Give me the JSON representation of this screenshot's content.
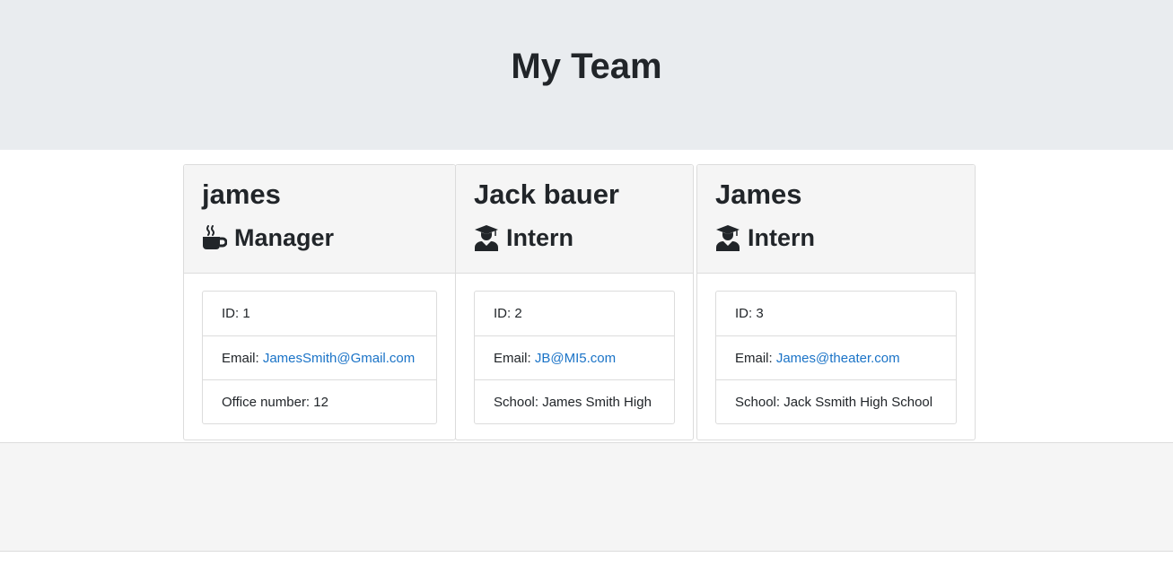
{
  "page": {
    "title": "My Team"
  },
  "team": [
    {
      "name": "james",
      "role": "Manager",
      "role_icon": "coffee-mug-icon",
      "id_label": "ID: 1",
      "email_prefix": "Email: ",
      "email": "JamesSmith@Gmail.com",
      "extra_label": "Office number: 12"
    },
    {
      "name": "Jack bauer",
      "role": "Intern",
      "role_icon": "graduate-icon",
      "id_label": "ID: 2",
      "email_prefix": "Email: ",
      "email": "JB@MI5.com",
      "extra_label": "School: James Smith High"
    },
    {
      "name": "James",
      "role": "Intern",
      "role_icon": "graduate-icon",
      "id_label": "ID: 3",
      "email_prefix": "Email: ",
      "email": "James@theater.com",
      "extra_label": "School: Jack Ssmith High School"
    }
  ],
  "colors": {
    "header_bg": "#e9ecef",
    "card_header_bg": "#f5f5f5",
    "link": "#1a73c7",
    "text": "#212529"
  }
}
